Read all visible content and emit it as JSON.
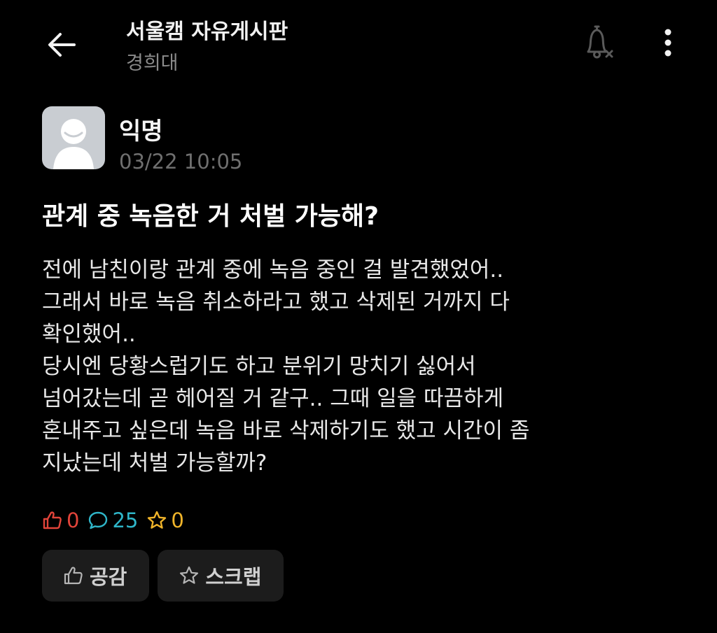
{
  "header": {
    "board_title": "서울캠 자유게시판",
    "board_subtitle": "경희대"
  },
  "post": {
    "author": "익명",
    "time": "03/22 10:05",
    "title": "관계 중 녹음한 거 처벌 가능해?",
    "body_lines": [
      "전에 남친이랑 관계 중에 녹음 중인 걸 발견했었어..",
      "그래서 바로 녹음 취소하라고 했고 삭제된 거까지 다",
      "확인했어..",
      "당시엔 당황스럽기도 하고 분위기 망치기 싫어서",
      "넘어갔는데 곧 헤어질 거 같구.. 그때 일을 따끔하게",
      "혼내주고 싶은데 녹음 바로 삭제하기도 했고 시간이 좀",
      "지났는데 처벌 가능할까?"
    ]
  },
  "stats": {
    "likes": "0",
    "comments": "25",
    "scraps": "0"
  },
  "actions": {
    "like_label": "공감",
    "scrap_label": "스크랩"
  },
  "colors": {
    "background": "#000000",
    "like": "#e2443a",
    "comment": "#2fb6c9",
    "scrap": "#f0b42a",
    "button_bg": "#1c1c1c"
  },
  "icons": {
    "back": "arrow-left-icon",
    "notification": "bell-off-icon",
    "more": "more-vertical-icon",
    "like": "thumbs-up-icon",
    "comment": "speech-bubble-icon",
    "scrap": "star-icon"
  }
}
